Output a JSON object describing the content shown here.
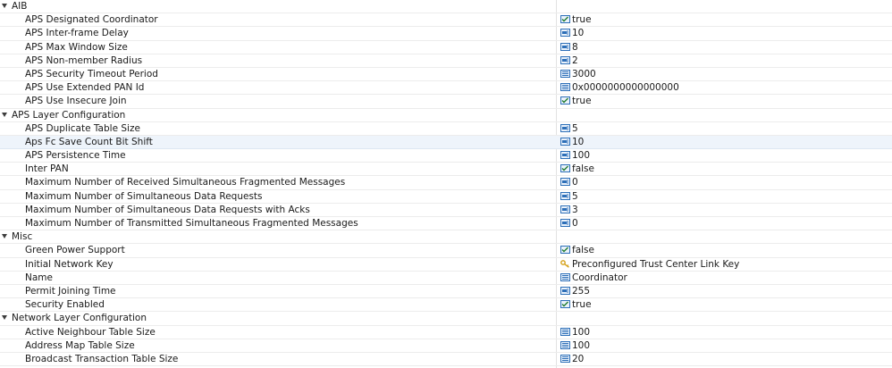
{
  "categories": [
    {
      "label": "AIB",
      "expanded": true,
      "props": [
        {
          "name": "APS Designated Coordinator",
          "value": "true",
          "icon": "checkbox-icon"
        },
        {
          "name": "APS Inter-frame Delay",
          "value": "10",
          "icon": "number-icon"
        },
        {
          "name": "APS Max Window Size",
          "value": "8",
          "icon": "number-icon"
        },
        {
          "name": "APS Non-member Radius",
          "value": "2",
          "icon": "number-icon"
        },
        {
          "name": "APS Security Timeout Period",
          "value": "3000",
          "icon": "text-list-icon"
        },
        {
          "name": "APS Use Extended PAN Id",
          "value": "0x0000000000000000",
          "icon": "text-list-icon"
        },
        {
          "name": "APS Use Insecure Join",
          "value": "true",
          "icon": "checkbox-icon"
        }
      ]
    },
    {
      "label": "APS Layer Configuration",
      "expanded": true,
      "props": [
        {
          "name": "APS Duplicate Table Size",
          "value": "5",
          "icon": "number-icon"
        },
        {
          "name": "Aps Fc Save Count Bit Shift",
          "value": "10",
          "icon": "number-icon",
          "highlighted": true
        },
        {
          "name": "APS Persistence Time",
          "value": "100",
          "icon": "number-icon"
        },
        {
          "name": "Inter PAN",
          "value": "false",
          "icon": "checkbox-icon"
        },
        {
          "name": "Maximum Number of Received Simultaneous Fragmented Messages",
          "value": "0",
          "icon": "number-icon"
        },
        {
          "name": "Maximum Number of Simultaneous Data Requests",
          "value": "5",
          "icon": "number-icon"
        },
        {
          "name": "Maximum Number of Simultaneous Data Requests with Acks",
          "value": "3",
          "icon": "number-icon"
        },
        {
          "name": "Maximum Number of Transmitted Simultaneous Fragmented Messages",
          "value": "0",
          "icon": "number-icon"
        }
      ]
    },
    {
      "label": "Misc",
      "expanded": true,
      "props": [
        {
          "name": "Green Power Support",
          "value": "false",
          "icon": "checkbox-icon"
        },
        {
          "name": "Initial Network Key",
          "value": "Preconfigured Trust Center Link Key",
          "icon": "key-icon"
        },
        {
          "name": "Name",
          "value": "Coordinator",
          "icon": "text-list-icon"
        },
        {
          "name": "Permit Joining Time",
          "value": "255",
          "icon": "number-icon"
        },
        {
          "name": "Security Enabled",
          "value": "true",
          "icon": "checkbox-icon"
        }
      ]
    },
    {
      "label": "Network Layer Configuration",
      "expanded": true,
      "props": [
        {
          "name": "Active Neighbour Table Size",
          "value": "100",
          "icon": "text-list-icon"
        },
        {
          "name": "Address Map Table Size",
          "value": "100",
          "icon": "text-list-icon"
        },
        {
          "name": "Broadcast Transaction Table Size",
          "value": "20",
          "icon": "text-list-icon"
        }
      ]
    }
  ],
  "colors": {
    "icon_blue": "#2d6fb8",
    "key_yellow": "#d4a017",
    "highlight": "#eef4fb"
  }
}
